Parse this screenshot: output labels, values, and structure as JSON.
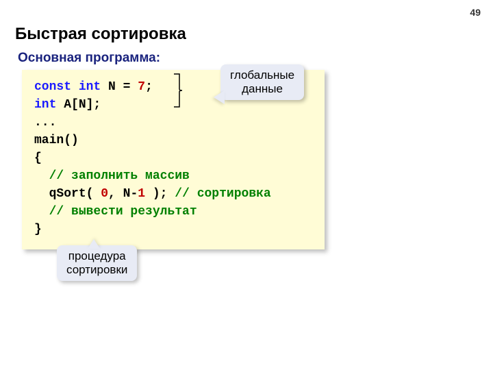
{
  "page_number": "49",
  "title": "Быстрая сортировка",
  "subtitle": "Основная программа:",
  "callouts": {
    "top": "глобальные\nданные",
    "bottom": "процедура\nсортировки"
  },
  "code": {
    "l1_kw1": "const",
    "l1_kw2": "int",
    "l1_name": "N",
    "l1_eq": "=",
    "l1_val": "7",
    "l1_semi": ";",
    "l2_kw": "int",
    "l2_rest": "A[N];",
    "l3": "...",
    "l4": "main()",
    "l5": "{",
    "l6_indent": "  ",
    "l6_cmt": "// заполнить массив",
    "l7_indent": "  ",
    "l7_a": "qSort( ",
    "l7_n0": "0",
    "l7_b": ", N-",
    "l7_n1": "1",
    "l7_c": " ); ",
    "l7_cmt": "// сортировка",
    "l8_indent": "  ",
    "l8_cmt": "// вывести результат",
    "l9": "}"
  }
}
